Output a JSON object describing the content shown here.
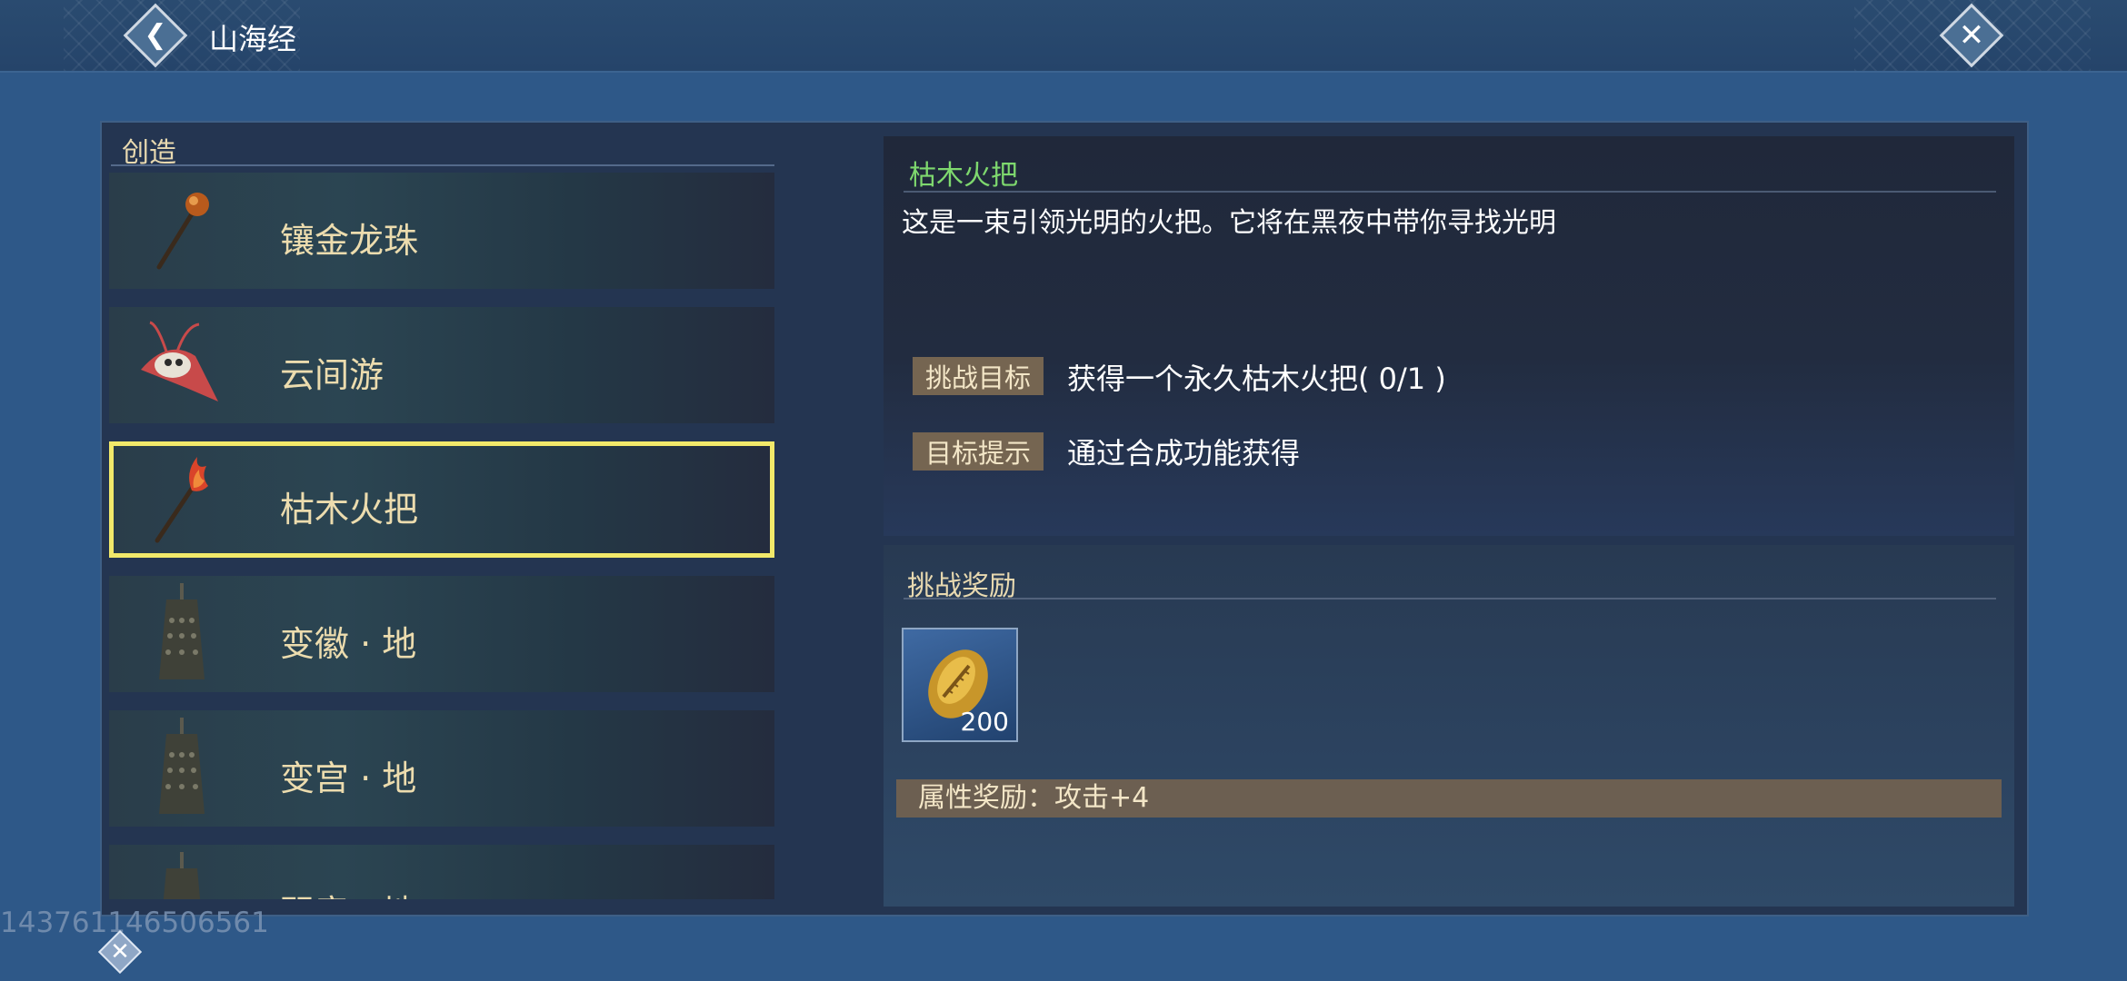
{
  "header": {
    "title": "山海经",
    "back_icon": "chevron-left-icon",
    "close_icon": "close-icon"
  },
  "category": {
    "title": "创造"
  },
  "items": [
    {
      "name": "镶金龙珠",
      "icon": "staff-orb-icon"
    },
    {
      "name": "云间游",
      "icon": "moth-kite-icon"
    },
    {
      "name": "枯木火把",
      "icon": "torch-icon",
      "selected": true
    },
    {
      "name": "变徽 · 地",
      "icon": "bell-icon"
    },
    {
      "name": "变宫 · 地",
      "icon": "bell-icon"
    },
    {
      "name": "羽音 · 地",
      "icon": "bell-icon"
    }
  ],
  "detail": {
    "title": "枯木火把",
    "description": "这是一束引领光明的火把。它将在黑夜中带你寻找光明",
    "goal_label": "挑战目标",
    "goal_text": "获得一个永久枯木火把( 0/1 )",
    "hint_label": "目标提示",
    "hint_text": "通过合成功能获得"
  },
  "reward": {
    "title": "挑战奖励",
    "item_icon": "gold-shell-icon",
    "item_count": "200",
    "bonus_text": "属性奖励：攻击+4"
  },
  "footer": {
    "uid": "143761146506561"
  },
  "colors": {
    "background": "#2e5888",
    "selected_border": "#f2e96a",
    "title_green": "#7ed86e",
    "tag_bg": "#756551"
  }
}
